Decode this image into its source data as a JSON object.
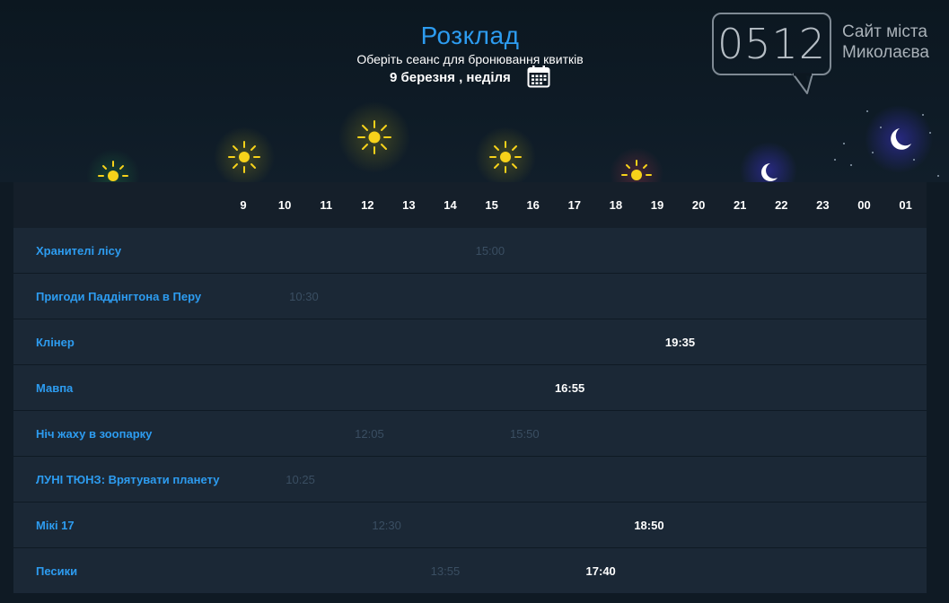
{
  "header": {
    "title": "Розклад",
    "subtitle": "Оберіть сеанс для бронювання квитків",
    "date": "9 березня , неділя"
  },
  "logo": {
    "number": "0512",
    "line1": "Сайт міста",
    "line2": "Миколаєва"
  },
  "hours": [
    "9",
    "10",
    "11",
    "12",
    "13",
    "14",
    "15",
    "16",
    "17",
    "18",
    "19",
    "20",
    "21",
    "22",
    "23",
    "00",
    "01"
  ],
  "movies": [
    {
      "title": "Хранителі лісу",
      "shows": [
        {
          "time": "15:00",
          "state": "past"
        }
      ]
    },
    {
      "title": "Пригоди Паддінгтона в Перу",
      "shows": [
        {
          "time": "10:30",
          "state": "past"
        }
      ]
    },
    {
      "title": "Клінер",
      "shows": [
        {
          "time": "19:35",
          "state": "active"
        }
      ]
    },
    {
      "title": "Мавпа",
      "shows": [
        {
          "time": "16:55",
          "state": "active"
        }
      ]
    },
    {
      "title": "Ніч жаху в зоопарку",
      "shows": [
        {
          "time": "12:05",
          "state": "past"
        },
        {
          "time": "15:50",
          "state": "past"
        }
      ]
    },
    {
      "title": "ЛУНІ ТЮНЗ: Врятувати планету",
      "shows": [
        {
          "time": "10:25",
          "state": "past"
        }
      ]
    },
    {
      "title": "Мікі 17",
      "shows": [
        {
          "time": "12:30",
          "state": "past"
        },
        {
          "time": "18:50",
          "state": "active"
        }
      ]
    },
    {
      "title": "Песики",
      "shows": [
        {
          "time": "13:55",
          "state": "past"
        },
        {
          "time": "17:40",
          "state": "active"
        }
      ]
    }
  ],
  "colors": {
    "accent": "#2d9cf0",
    "past": "#3a4e62",
    "active": "#ffffff",
    "sun": "#f7d21a",
    "moon": "#ffffff"
  },
  "icons": [
    "calendar-icon",
    "sun-icon",
    "moon-icon",
    "speech-bubble-logo"
  ]
}
